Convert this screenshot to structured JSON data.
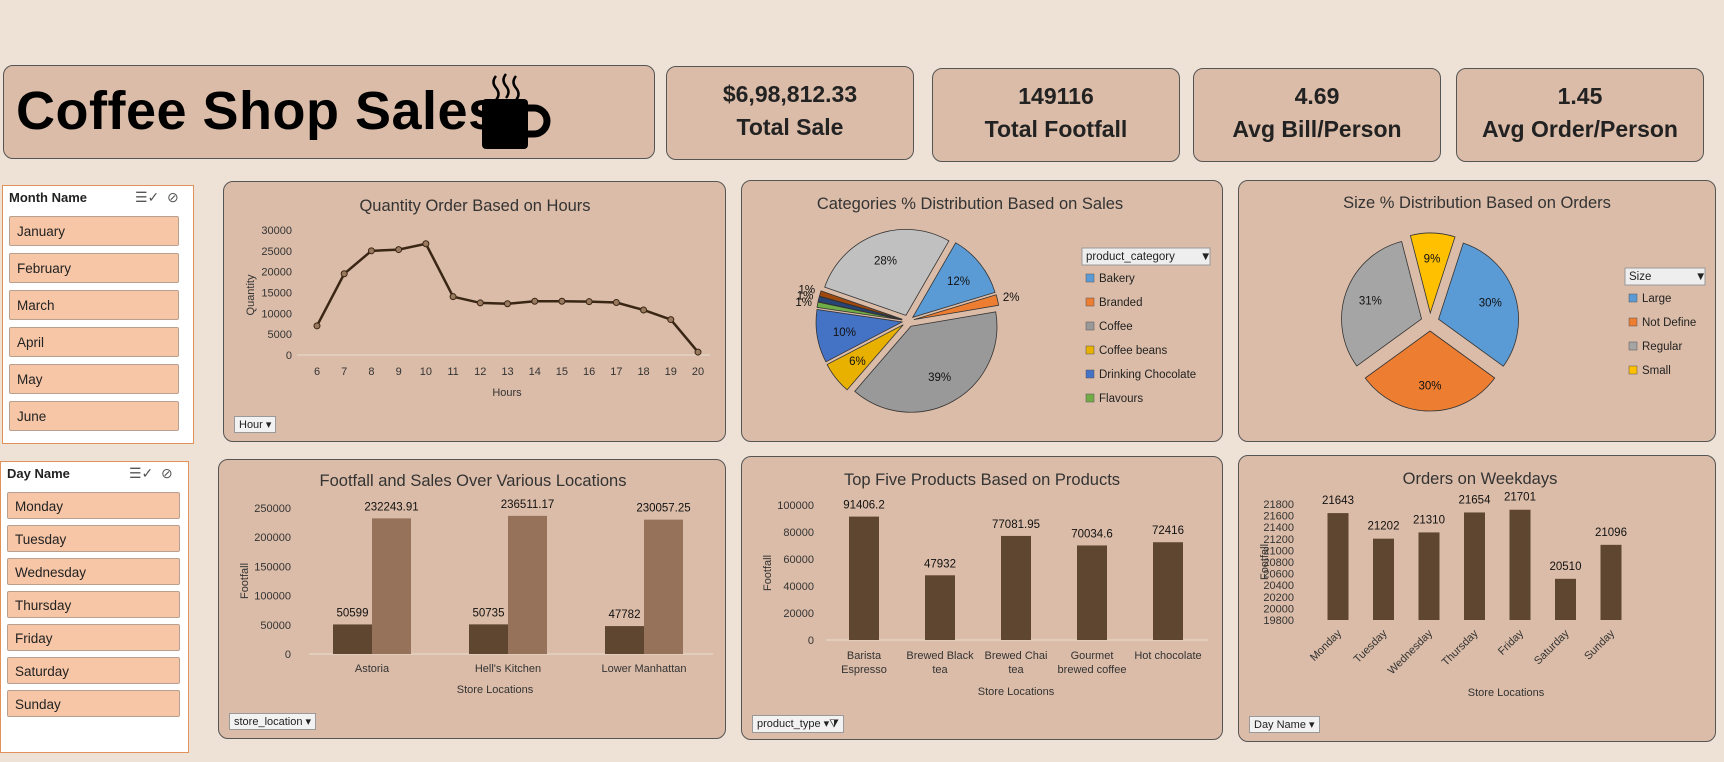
{
  "title": "Coffee Shop Sales",
  "kpis": [
    {
      "value": "$6,98,812.33",
      "label": "Total Sale"
    },
    {
      "value": "149116",
      "label": "Total Footfall"
    },
    {
      "value": "4.69",
      "label": "Avg Bill/Person"
    },
    {
      "value": "1.45",
      "label": "Avg Order/Person"
    }
  ],
  "month_slicer": {
    "header": "Month Name",
    "items": [
      "January",
      "February",
      "March",
      "April",
      "May",
      "June"
    ]
  },
  "day_slicer": {
    "header": "Day Name",
    "items": [
      "Monday",
      "Tuesday",
      "Wednesday",
      "Thursday",
      "Friday",
      "Saturday",
      "Sunday"
    ]
  },
  "colors": {
    "dark_brown": "#5e4631",
    "light_brown": "#957259",
    "line": "#3a2615"
  },
  "chart_data": [
    {
      "id": "hours",
      "type": "line",
      "title": "Quantity Order Based on Hours",
      "xlabel": "Hours",
      "ylabel": "Quantity",
      "filter_button": "Hour",
      "x": [
        6,
        7,
        8,
        9,
        10,
        11,
        12,
        13,
        14,
        15,
        16,
        17,
        18,
        19,
        20
      ],
      "values": [
        7000,
        19500,
        25000,
        25300,
        26700,
        14000,
        12500,
        12300,
        12900,
        12900,
        12800,
        12600,
        10800,
        8500,
        700
      ],
      "ylim": [
        0,
        30000
      ],
      "yticks": [
        0,
        5000,
        10000,
        15000,
        20000,
        25000,
        30000
      ]
    },
    {
      "id": "categories",
      "type": "pie",
      "title": "Categories % Distribution Based on Sales",
      "legend_title": "product_category",
      "legend": [
        "Bakery",
        "Branded",
        "Coffee",
        "Coffee beans",
        "Drinking Chocolate",
        "Flavours"
      ],
      "slices": [
        {
          "label": "Bakery",
          "value": 12,
          "display": "12%",
          "color": "#5b9bd5"
        },
        {
          "label": "Branded",
          "value": 2,
          "display": "2%",
          "color": "#ed7d31"
        },
        {
          "label": "Coffee",
          "value": 39,
          "display": "39%",
          "color": "#999999"
        },
        {
          "label": "Coffee beans",
          "value": 6,
          "display": "6%",
          "color": "#e8b100"
        },
        {
          "label": "Drinking Chocolate",
          "value": 10,
          "display": "10%",
          "color": "#4472c4"
        },
        {
          "label": "Flavours",
          "value": 1,
          "display": "1%",
          "color": "#70ad47"
        },
        {
          "label": "",
          "value": 1,
          "display": "1%",
          "color": "#264478"
        },
        {
          "label": "",
          "value": 1,
          "display": "1%",
          "color": "#9e480e"
        },
        {
          "label": "",
          "value": 28,
          "display": "28%",
          "color": "#c0c0c0"
        }
      ]
    },
    {
      "id": "sizes",
      "type": "pie",
      "title": "Size % Distribution Based on Orders",
      "legend_title": "Size",
      "legend": [
        "Large",
        "Not Define",
        "Regular",
        "Small"
      ],
      "slices": [
        {
          "label": "Large",
          "value": 30,
          "display": "30%",
          "color": "#5b9bd5"
        },
        {
          "label": "Not Define",
          "value": 30,
          "display": "30%",
          "color": "#ed7d31"
        },
        {
          "label": "Regular",
          "value": 31,
          "display": "31%",
          "color": "#a5a5a5"
        },
        {
          "label": "Small",
          "value": 9,
          "display": "9%",
          "color": "#ffc000"
        }
      ]
    },
    {
      "id": "locations",
      "type": "bar",
      "title": "Footfall and Sales Over Various Locations",
      "xlabel": "Store Locations",
      "ylabel": "Footfall",
      "filter_button": "store_location",
      "categories": [
        "Astoria",
        "Hell's Kitchen",
        "Lower Manhattan"
      ],
      "series": [
        {
          "values": [
            50599,
            50735,
            47782
          ],
          "labels": [
            "50599",
            "50735",
            "47782"
          ]
        },
        {
          "values": [
            232243.91,
            236511.17,
            230057.25
          ],
          "labels": [
            "232243.91",
            "236511.17",
            "230057.25"
          ]
        }
      ],
      "ylim": [
        0,
        250000
      ],
      "yticks": [
        0,
        50000,
        100000,
        150000,
        200000,
        250000
      ]
    },
    {
      "id": "products",
      "type": "bar",
      "title": "Top Five Products Based on Products",
      "xlabel": "Store Locations",
      "ylabel": "Footfall",
      "filter_button": "product_type",
      "categories": [
        [
          "Barista",
          "Espresso"
        ],
        [
          "Brewed Black",
          "tea"
        ],
        [
          "Brewed Chai",
          "tea"
        ],
        [
          "Gourmet",
          "brewed coffee"
        ],
        [
          "Hot chocolate"
        ]
      ],
      "values": [
        91406.2,
        47932,
        77081.95,
        70034.6,
        72416
      ],
      "labels": [
        "91406.2",
        "47932",
        "77081.95",
        "70034.6",
        "72416"
      ],
      "ylim": [
        0,
        100000
      ],
      "yticks": [
        0,
        20000,
        40000,
        60000,
        80000,
        100000
      ]
    },
    {
      "id": "weekdays",
      "type": "bar",
      "title": "Orders on Weekdays",
      "xlabel": "Store Locations",
      "ylabel": "Footfall",
      "filter_button": "Day Name",
      "categories": [
        "Monday",
        "Tuesday",
        "Wednesday",
        "Thursday",
        "Friday",
        "Saturday",
        "Sunday"
      ],
      "values": [
        21643,
        21202,
        21310,
        21654,
        21701,
        20510,
        21096
      ],
      "labels": [
        "21643",
        "21202",
        "21310",
        "21654",
        "21701",
        "20510",
        "21096"
      ],
      "ylim": [
        19800,
        21800
      ],
      "yticks": [
        19800,
        20000,
        20200,
        20400,
        20600,
        20800,
        21000,
        21200,
        21400,
        21600,
        21800
      ]
    }
  ]
}
